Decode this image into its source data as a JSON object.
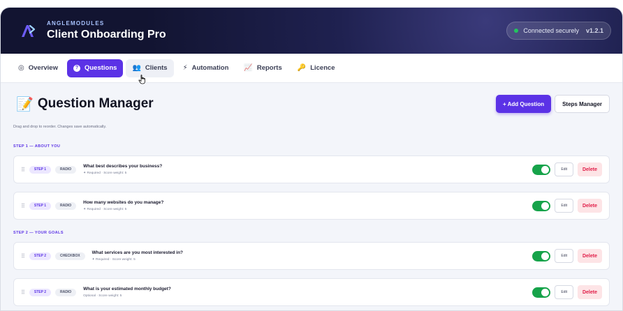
{
  "header": {
    "brand_small": "ANGLEMODULES",
    "app_title": "Client Onboarding Pro",
    "status_text": "Connected securely",
    "version": "v1.2.1",
    "status_color": "#22c55e"
  },
  "nav": {
    "tabs": [
      {
        "label": "Overview",
        "icon": "gauge-icon",
        "glyph": "◎"
      },
      {
        "label": "Questions",
        "icon": "question-icon",
        "glyph": "?"
      },
      {
        "label": "Clients",
        "icon": "users-icon",
        "glyph": "👥"
      },
      {
        "label": "Automation",
        "icon": "bolt-icon",
        "glyph": "⚡"
      },
      {
        "label": "Reports",
        "icon": "chart-icon",
        "glyph": "📈"
      },
      {
        "label": "Licence",
        "icon": "key-icon",
        "glyph": "🔑"
      }
    ],
    "active": "Questions",
    "hovered": "Clients"
  },
  "page": {
    "emoji": "📝",
    "title": "Question Manager",
    "add_button": "+ Add Question",
    "steps_button": "Steps Manager",
    "hint": "Drag and drop to reorder. Changes save automatically."
  },
  "sections": [
    {
      "label": "STEP 1 — ABOUT YOU",
      "questions": [
        {
          "step": "STEP 1",
          "type": "RADIO",
          "title": "What best describes your business?",
          "meta": "✦ Required · Score weight: 5",
          "enabled": true,
          "edit": "Edit",
          "delete": "Delete"
        },
        {
          "step": "STEP 1",
          "type": "RADIO",
          "title": "How many websites do you manage?",
          "meta": "✦ Required · Score weight: 5",
          "enabled": true,
          "edit": "Edit",
          "delete": "Delete"
        }
      ]
    },
    {
      "label": "STEP 2 — YOUR GOALS",
      "questions": [
        {
          "step": "STEP 2",
          "type": "CHECKBOX",
          "title": "What services are you most interested in?",
          "meta": "✦ Required · Score weight: 5",
          "enabled": true,
          "edit": "Edit",
          "delete": "Delete"
        },
        {
          "step": "STEP 2",
          "type": "RADIO",
          "title": "What is your estimated monthly budget?",
          "meta": "Optional · Score weight: 5",
          "enabled": true,
          "edit": "Edit",
          "delete": "Delete"
        }
      ]
    }
  ],
  "colors": {
    "accent": "#5b32e6",
    "toggle_on": "#16a34a",
    "danger": "#e11d48"
  }
}
